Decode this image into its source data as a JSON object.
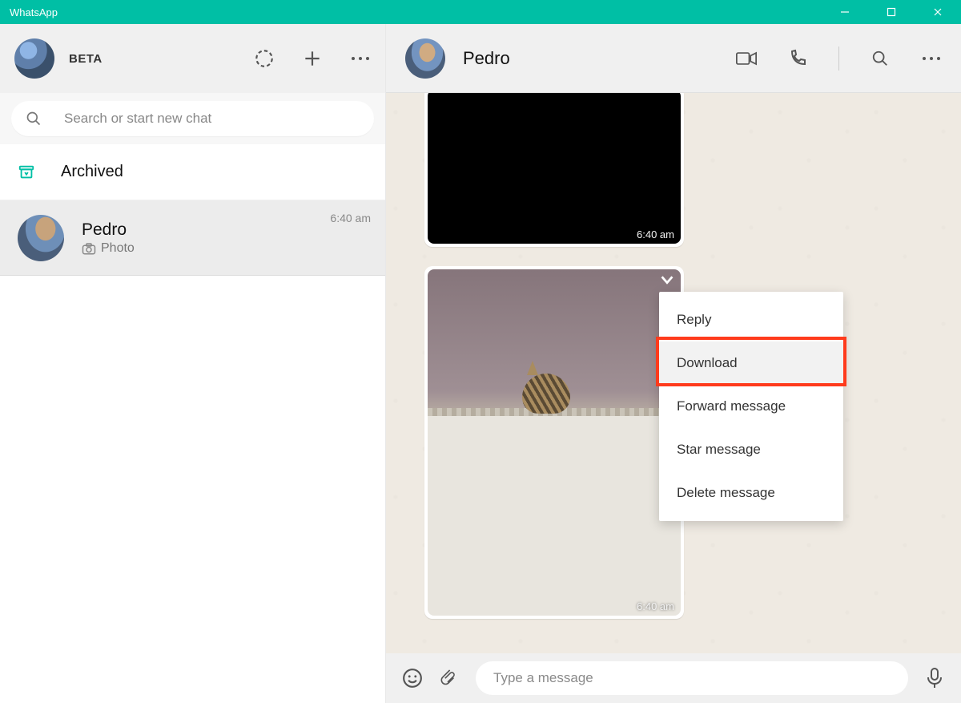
{
  "window": {
    "title": "WhatsApp"
  },
  "sidebar": {
    "badge": "BETA",
    "search_placeholder": "Search or start new chat",
    "archived_label": "Archived",
    "chats": [
      {
        "name": "Pedro",
        "preview": "Photo",
        "time": "6:40 am"
      }
    ]
  },
  "chat": {
    "contact_name": "Pedro",
    "messages": [
      {
        "type": "image",
        "time": "6:40 am"
      },
      {
        "type": "image",
        "time": "6:40 am"
      }
    ],
    "composer_placeholder": "Type a message"
  },
  "context_menu": {
    "items": [
      {
        "label": "Reply",
        "selected": false
      },
      {
        "label": "Download",
        "selected": true,
        "highlighted": true
      },
      {
        "label": "Forward message",
        "selected": false
      },
      {
        "label": "Star message",
        "selected": false
      },
      {
        "label": "Delete message",
        "selected": false
      }
    ]
  }
}
